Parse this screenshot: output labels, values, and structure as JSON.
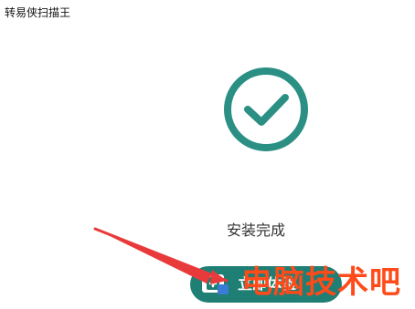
{
  "window": {
    "title": "转易侠扫描王"
  },
  "status": {
    "text": "安装完成",
    "accent_color": "#2b8f84",
    "icon": "check-circle-icon"
  },
  "start_button": {
    "label": "立即体验",
    "icon": "scanner-icon",
    "color": "#1f7f74"
  },
  "overlay": {
    "arrow_icon": "red-arrow-annotation",
    "watermark": "电脑技术吧",
    "watermark_color": "#ff4a1a"
  }
}
